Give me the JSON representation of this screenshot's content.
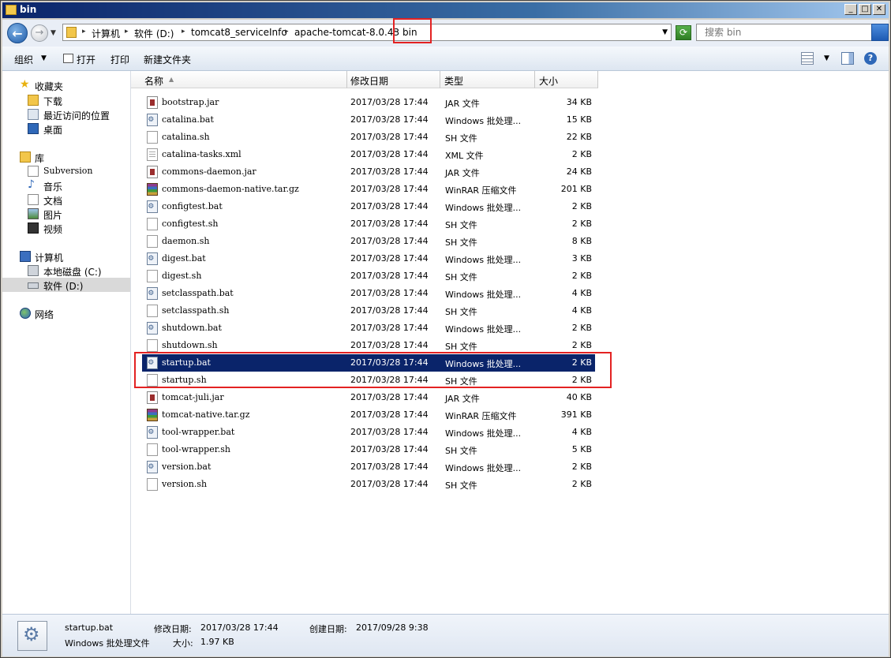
{
  "window": {
    "title": "bin"
  },
  "address": {
    "crumbs": [
      "计算机",
      "软件 (D:)",
      "tomcat8_serviceInfo",
      "apache-tomcat-8.0.43",
      "bin"
    ]
  },
  "search": {
    "placeholder": "搜索 bin"
  },
  "toolbar": {
    "organize": "组织",
    "open": "打开",
    "print": "打印",
    "new_folder": "新建文件夹"
  },
  "sidebar": {
    "favorites": {
      "label": "收藏夹",
      "items": [
        "下载",
        "最近访问的位置",
        "桌面"
      ]
    },
    "libraries": {
      "label": "库",
      "items": [
        "Subversion",
        "音乐",
        "文档",
        "图片",
        "视频"
      ]
    },
    "computer": {
      "label": "计算机",
      "items": [
        "本地磁盘 (C:)",
        "软件 (D:)"
      ]
    },
    "network": {
      "label": "网络"
    }
  },
  "columns": {
    "name": "名称",
    "date": "修改日期",
    "type": "类型",
    "size": "大小"
  },
  "files": [
    {
      "name": "bootstrap.jar",
      "date": "2017/03/28 17:44",
      "type": "JAR 文件",
      "size": "34 KB",
      "icon": "jar-file-icon"
    },
    {
      "name": "catalina.bat",
      "date": "2017/03/28 17:44",
      "type": "Windows 批处理...",
      "size": "15 KB",
      "icon": "batch-file-icon"
    },
    {
      "name": "catalina.sh",
      "date": "2017/03/28 17:44",
      "type": "SH 文件",
      "size": "22 KB",
      "icon": "text-file-icon"
    },
    {
      "name": "catalina-tasks.xml",
      "date": "2017/03/28 17:44",
      "type": "XML 文件",
      "size": "2 KB",
      "icon": "xml-file-icon"
    },
    {
      "name": "commons-daemon.jar",
      "date": "2017/03/28 17:44",
      "type": "JAR 文件",
      "size": "24 KB",
      "icon": "jar-file-icon"
    },
    {
      "name": "commons-daemon-native.tar.gz",
      "date": "2017/03/28 17:44",
      "type": "WinRAR 压缩文件",
      "size": "201 KB",
      "icon": "winrar-archive-icon"
    },
    {
      "name": "configtest.bat",
      "date": "2017/03/28 17:44",
      "type": "Windows 批处理...",
      "size": "2 KB",
      "icon": "batch-file-icon"
    },
    {
      "name": "configtest.sh",
      "date": "2017/03/28 17:44",
      "type": "SH 文件",
      "size": "2 KB",
      "icon": "text-file-icon"
    },
    {
      "name": "daemon.sh",
      "date": "2017/03/28 17:44",
      "type": "SH 文件",
      "size": "8 KB",
      "icon": "text-file-icon"
    },
    {
      "name": "digest.bat",
      "date": "2017/03/28 17:44",
      "type": "Windows 批处理...",
      "size": "3 KB",
      "icon": "batch-file-icon"
    },
    {
      "name": "digest.sh",
      "date": "2017/03/28 17:44",
      "type": "SH 文件",
      "size": "2 KB",
      "icon": "text-file-icon"
    },
    {
      "name": "setclasspath.bat",
      "date": "2017/03/28 17:44",
      "type": "Windows 批处理...",
      "size": "4 KB",
      "icon": "batch-file-icon"
    },
    {
      "name": "setclasspath.sh",
      "date": "2017/03/28 17:44",
      "type": "SH 文件",
      "size": "4 KB",
      "icon": "text-file-icon"
    },
    {
      "name": "shutdown.bat",
      "date": "2017/03/28 17:44",
      "type": "Windows 批处理...",
      "size": "2 KB",
      "icon": "batch-file-icon"
    },
    {
      "name": "shutdown.sh",
      "date": "2017/03/28 17:44",
      "type": "SH 文件",
      "size": "2 KB",
      "icon": "text-file-icon"
    },
    {
      "name": "startup.bat",
      "date": "2017/03/28 17:44",
      "type": "Windows 批处理...",
      "size": "2 KB",
      "icon": "batch-file-icon",
      "selected": true
    },
    {
      "name": "startup.sh",
      "date": "2017/03/28 17:44",
      "type": "SH 文件",
      "size": "2 KB",
      "icon": "text-file-icon"
    },
    {
      "name": "tomcat-juli.jar",
      "date": "2017/03/28 17:44",
      "type": "JAR 文件",
      "size": "40 KB",
      "icon": "jar-file-icon"
    },
    {
      "name": "tomcat-native.tar.gz",
      "date": "2017/03/28 17:44",
      "type": "WinRAR 压缩文件",
      "size": "391 KB",
      "icon": "winrar-archive-icon"
    },
    {
      "name": "tool-wrapper.bat",
      "date": "2017/03/28 17:44",
      "type": "Windows 批处理...",
      "size": "4 KB",
      "icon": "batch-file-icon"
    },
    {
      "name": "tool-wrapper.sh",
      "date": "2017/03/28 17:44",
      "type": "SH 文件",
      "size": "5 KB",
      "icon": "text-file-icon"
    },
    {
      "name": "version.bat",
      "date": "2017/03/28 17:44",
      "type": "Windows 批处理...",
      "size": "2 KB",
      "icon": "batch-file-icon"
    },
    {
      "name": "version.sh",
      "date": "2017/03/28 17:44",
      "type": "SH 文件",
      "size": "2 KB",
      "icon": "text-file-icon"
    }
  ],
  "details": {
    "name": "startup.bat",
    "type": "Windows 批处理文件",
    "modified_label": "修改日期:",
    "modified": "2017/03/28 17:44",
    "created_label": "创建日期:",
    "created": "2017/09/28 9:38",
    "size_label": "大小:",
    "size": "1.97 KB"
  },
  "colors": {
    "highlight_box": "#e32222",
    "selection": "#0a246a"
  }
}
